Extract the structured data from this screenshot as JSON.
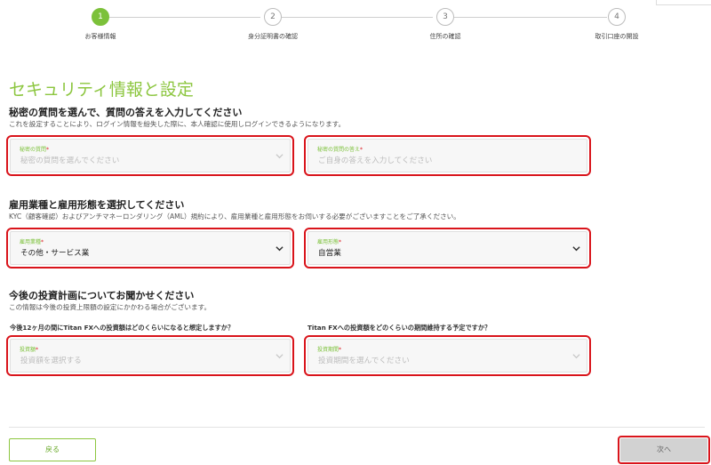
{
  "stepper": {
    "steps": [
      {
        "number": "1",
        "label": "お客様情報",
        "active": true
      },
      {
        "number": "2",
        "label": "身分証明書の確認",
        "active": false
      },
      {
        "number": "3",
        "label": "住所の確認",
        "active": false
      },
      {
        "number": "4",
        "label": "取引口座の開設",
        "active": false
      }
    ]
  },
  "page_title": "セキュリティ情報と設定",
  "security": {
    "title": "秘密の質問を選んで、質問の答えを入力してください",
    "description": "これを設定することにより、ログイン情報を紛失した際に、本人確認に使用しログインできるようになります。",
    "question_field": {
      "label": "秘密の質問",
      "required": "*",
      "placeholder": "秘密の質問を選んでください"
    },
    "answer_field": {
      "label": "秘密の質問の答え",
      "required": "*",
      "placeholder": "ご自身の答えを入力してください"
    }
  },
  "employment": {
    "title": "雇用業種と雇用形態を選択してください",
    "description": "KYC（顧客確認）およびアンチマネーロンダリング（AML）規約により、雇用業種と雇用形態をお伺いする必要がございますことをご了承ください。",
    "industry_field": {
      "label": "雇用業種",
      "required": "*",
      "value": "その他・サービス業"
    },
    "type_field": {
      "label": "雇用形態",
      "required": "*",
      "value": "自営業"
    }
  },
  "investment": {
    "title": "今後の投資計画についてお聞かせください",
    "description": "この情報は今後の投資上限額の設定にかかわる場合がございます。",
    "question_amount": "今後12ヶ月の間にTitan FXへの投資額はどのくらいになると想定しますか？",
    "question_period": "Titan FXへの投資額をどのくらいの期間維持する予定ですか？",
    "amount_field": {
      "label": "投資額",
      "required": "*",
      "placeholder": "投資額を選択する"
    },
    "period_field": {
      "label": "投資期間",
      "required": "*",
      "placeholder": "投資期間を選んでください"
    }
  },
  "footer": {
    "back_label": "戻る",
    "next_label": "次へ"
  },
  "colors": {
    "accent_green": "#8cc63f",
    "highlight_red": "#d9141b",
    "disabled_gray": "#d2d2d2"
  }
}
